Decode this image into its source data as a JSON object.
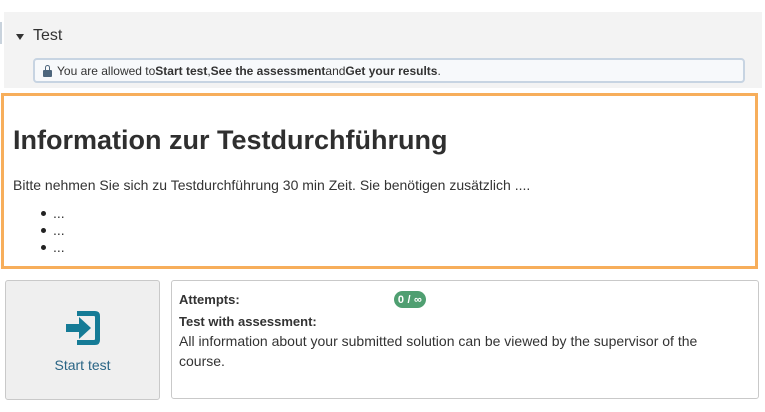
{
  "test_panel": {
    "title": "Test",
    "permission": {
      "prefix": "You are allowed to ",
      "action_start": "Start test",
      "comma": ", ",
      "action_view": "See the assessment",
      "conjunction": " and ",
      "action_results": "Get your results",
      "suffix": "."
    }
  },
  "info": {
    "title": "Information zur Testdurchführung",
    "text": "Bitte nehmen Sie sich zu Testdurchführung 30 min Zeit. Sie benötigen zusätzlich ....",
    "list": [
      "...",
      "...",
      "..."
    ]
  },
  "start": {
    "label": "Start test",
    "icon": "enter-icon"
  },
  "details": {
    "attempts_label": "Attempts:",
    "attempts_value": "0 / ∞",
    "assessment_title": "Test with assessment:",
    "assessment_text": "All information about your submitted solution can be viewed by the supervisor of the course."
  },
  "colors": {
    "accent_orange": "#f7ae5b",
    "icon_teal": "#157b96",
    "badge_green": "#4f9f71",
    "link_blue": "#2a6585"
  }
}
